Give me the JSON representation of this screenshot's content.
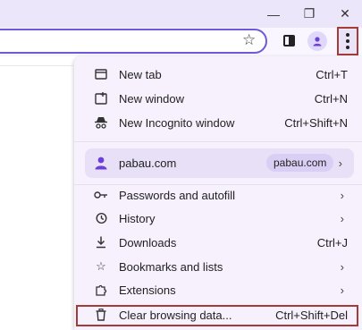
{
  "window_controls": {
    "minimize": "—",
    "restore": "❐",
    "close": "✕"
  },
  "toolbar": {
    "bookmark_icon": "star-outline",
    "side_panel_icon": "side-panel",
    "profile_icon": "person",
    "menu_icon": "three-dots-vertical"
  },
  "menu": {
    "items_top": [
      {
        "icon": "new-tab",
        "label": "New tab",
        "shortcut": "Ctrl+T"
      },
      {
        "icon": "new-window",
        "label": "New window",
        "shortcut": "Ctrl+N"
      },
      {
        "icon": "incognito",
        "label": "New Incognito window",
        "shortcut": "Ctrl+Shift+N"
      }
    ],
    "profile": {
      "name": "pabau.com",
      "chip": "pabau.com"
    },
    "items_middle": [
      {
        "icon": "key",
        "label": "Passwords and autofill"
      },
      {
        "icon": "history",
        "label": "History"
      },
      {
        "icon": "download",
        "label": "Downloads",
        "shortcut": "Ctrl+J"
      },
      {
        "icon": "star",
        "label": "Bookmarks and lists"
      },
      {
        "icon": "puzzle",
        "label": "Extensions"
      }
    ],
    "clear_browsing": {
      "icon": "trash",
      "label": "Clear browsing data...",
      "shortcut": "Ctrl+Shift+Del"
    }
  },
  "colors": {
    "accent_purple": "#6c3fd6",
    "highlight_red": "#a33b36",
    "menu_bg": "#f6f1fd"
  }
}
